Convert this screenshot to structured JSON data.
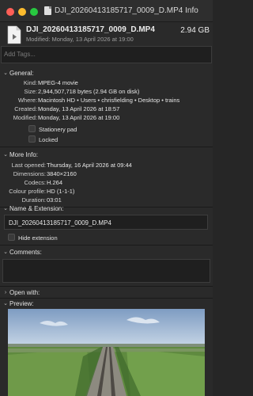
{
  "window": {
    "title": "DJI_20260413185717_0009_D.MP4 Info"
  },
  "file": {
    "name": "DJI_20260413185717_0009_D.MP4",
    "size": "2.94 GB",
    "modified": "Modified: Monday, 13 April 2026 at 19:00"
  },
  "tags": {
    "placeholder": "Add Tags..."
  },
  "general": {
    "title": "General:",
    "rows": [
      {
        "key": "Kind:",
        "value": "MPEG-4 movie"
      },
      {
        "key": "Size:",
        "value": "2,944,507,718 bytes (2.94 GB on disk)"
      },
      {
        "key": "Where:",
        "value": "Macintosh HD • Users • chrisfielding • Desktop • trains"
      },
      {
        "key": "Created:",
        "value": "Monday, 13 April 2026 at 18:57"
      },
      {
        "key": "Modified:",
        "value": "Monday, 13 April 2026 at 19:00"
      }
    ],
    "stationery": "Stationery pad",
    "locked": "Locked"
  },
  "more_info": {
    "title": "More Info:",
    "rows": [
      {
        "key": "Last opened:",
        "value": "Thursday, 16 April 2026 at 09:44"
      },
      {
        "key": "Dimensions:",
        "value": "3840×2160"
      },
      {
        "key": "Codecs:",
        "value": "H.264"
      },
      {
        "key": "Colour profile:",
        "value": "HD (1-1-1)"
      },
      {
        "key": "Duration:",
        "value": "03:01"
      }
    ]
  },
  "name_ext": {
    "title": "Name & Extension:",
    "value": "DJI_20260413185717_0009_D.MP4",
    "hide_extension": "Hide extension"
  },
  "comments": {
    "title": "Comments:"
  },
  "open_with": {
    "title": "Open with:"
  },
  "preview": {
    "title": "Preview:"
  },
  "colors": {
    "close": "#ff5f57",
    "minimize": "#febc2e",
    "zoom": "#28c840",
    "window_bg": "#2a2a2a"
  }
}
